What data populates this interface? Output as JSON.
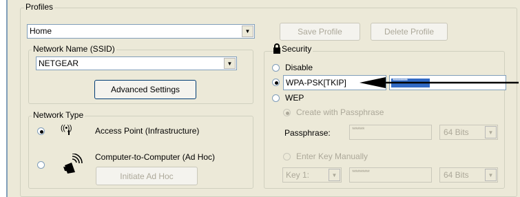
{
  "profiles": {
    "group_label": "Profiles",
    "selected_profile": "Home",
    "save_button": "Save Profile",
    "delete_button": "Delete Profile"
  },
  "network_name": {
    "group_label": "Network Name (SSID)",
    "ssid_value": "NETGEAR",
    "advanced_button": "Advanced Settings"
  },
  "network_type": {
    "group_label": "Network Type",
    "access_point_label": "Access Point (Infrastructure)",
    "access_point_selected": true,
    "adhoc_label": "Computer-to-Computer (Ad Hoc)",
    "initiate_adhoc_button": "Initiate Ad Hoc"
  },
  "security": {
    "group_label": "Security",
    "disable_label": "Disable",
    "wpa_mode": "WPA-PSK[TKIP]",
    "wpa_key_masked": "**********",
    "wep_label": "WEP",
    "create_passphrase_label": "Create with Passphrase",
    "passphrase_label": "Passphrase:",
    "passphrase_masked": "*******",
    "passphrase_bits": "64 Bits",
    "enter_key_label": "Enter Key Manually",
    "key_select": "Key 1:",
    "key_masked": "**********",
    "key_bits": "64 Bits"
  },
  "colors": {
    "panel_bg": "#ece9d8",
    "selection_blue": "#316ac5"
  }
}
